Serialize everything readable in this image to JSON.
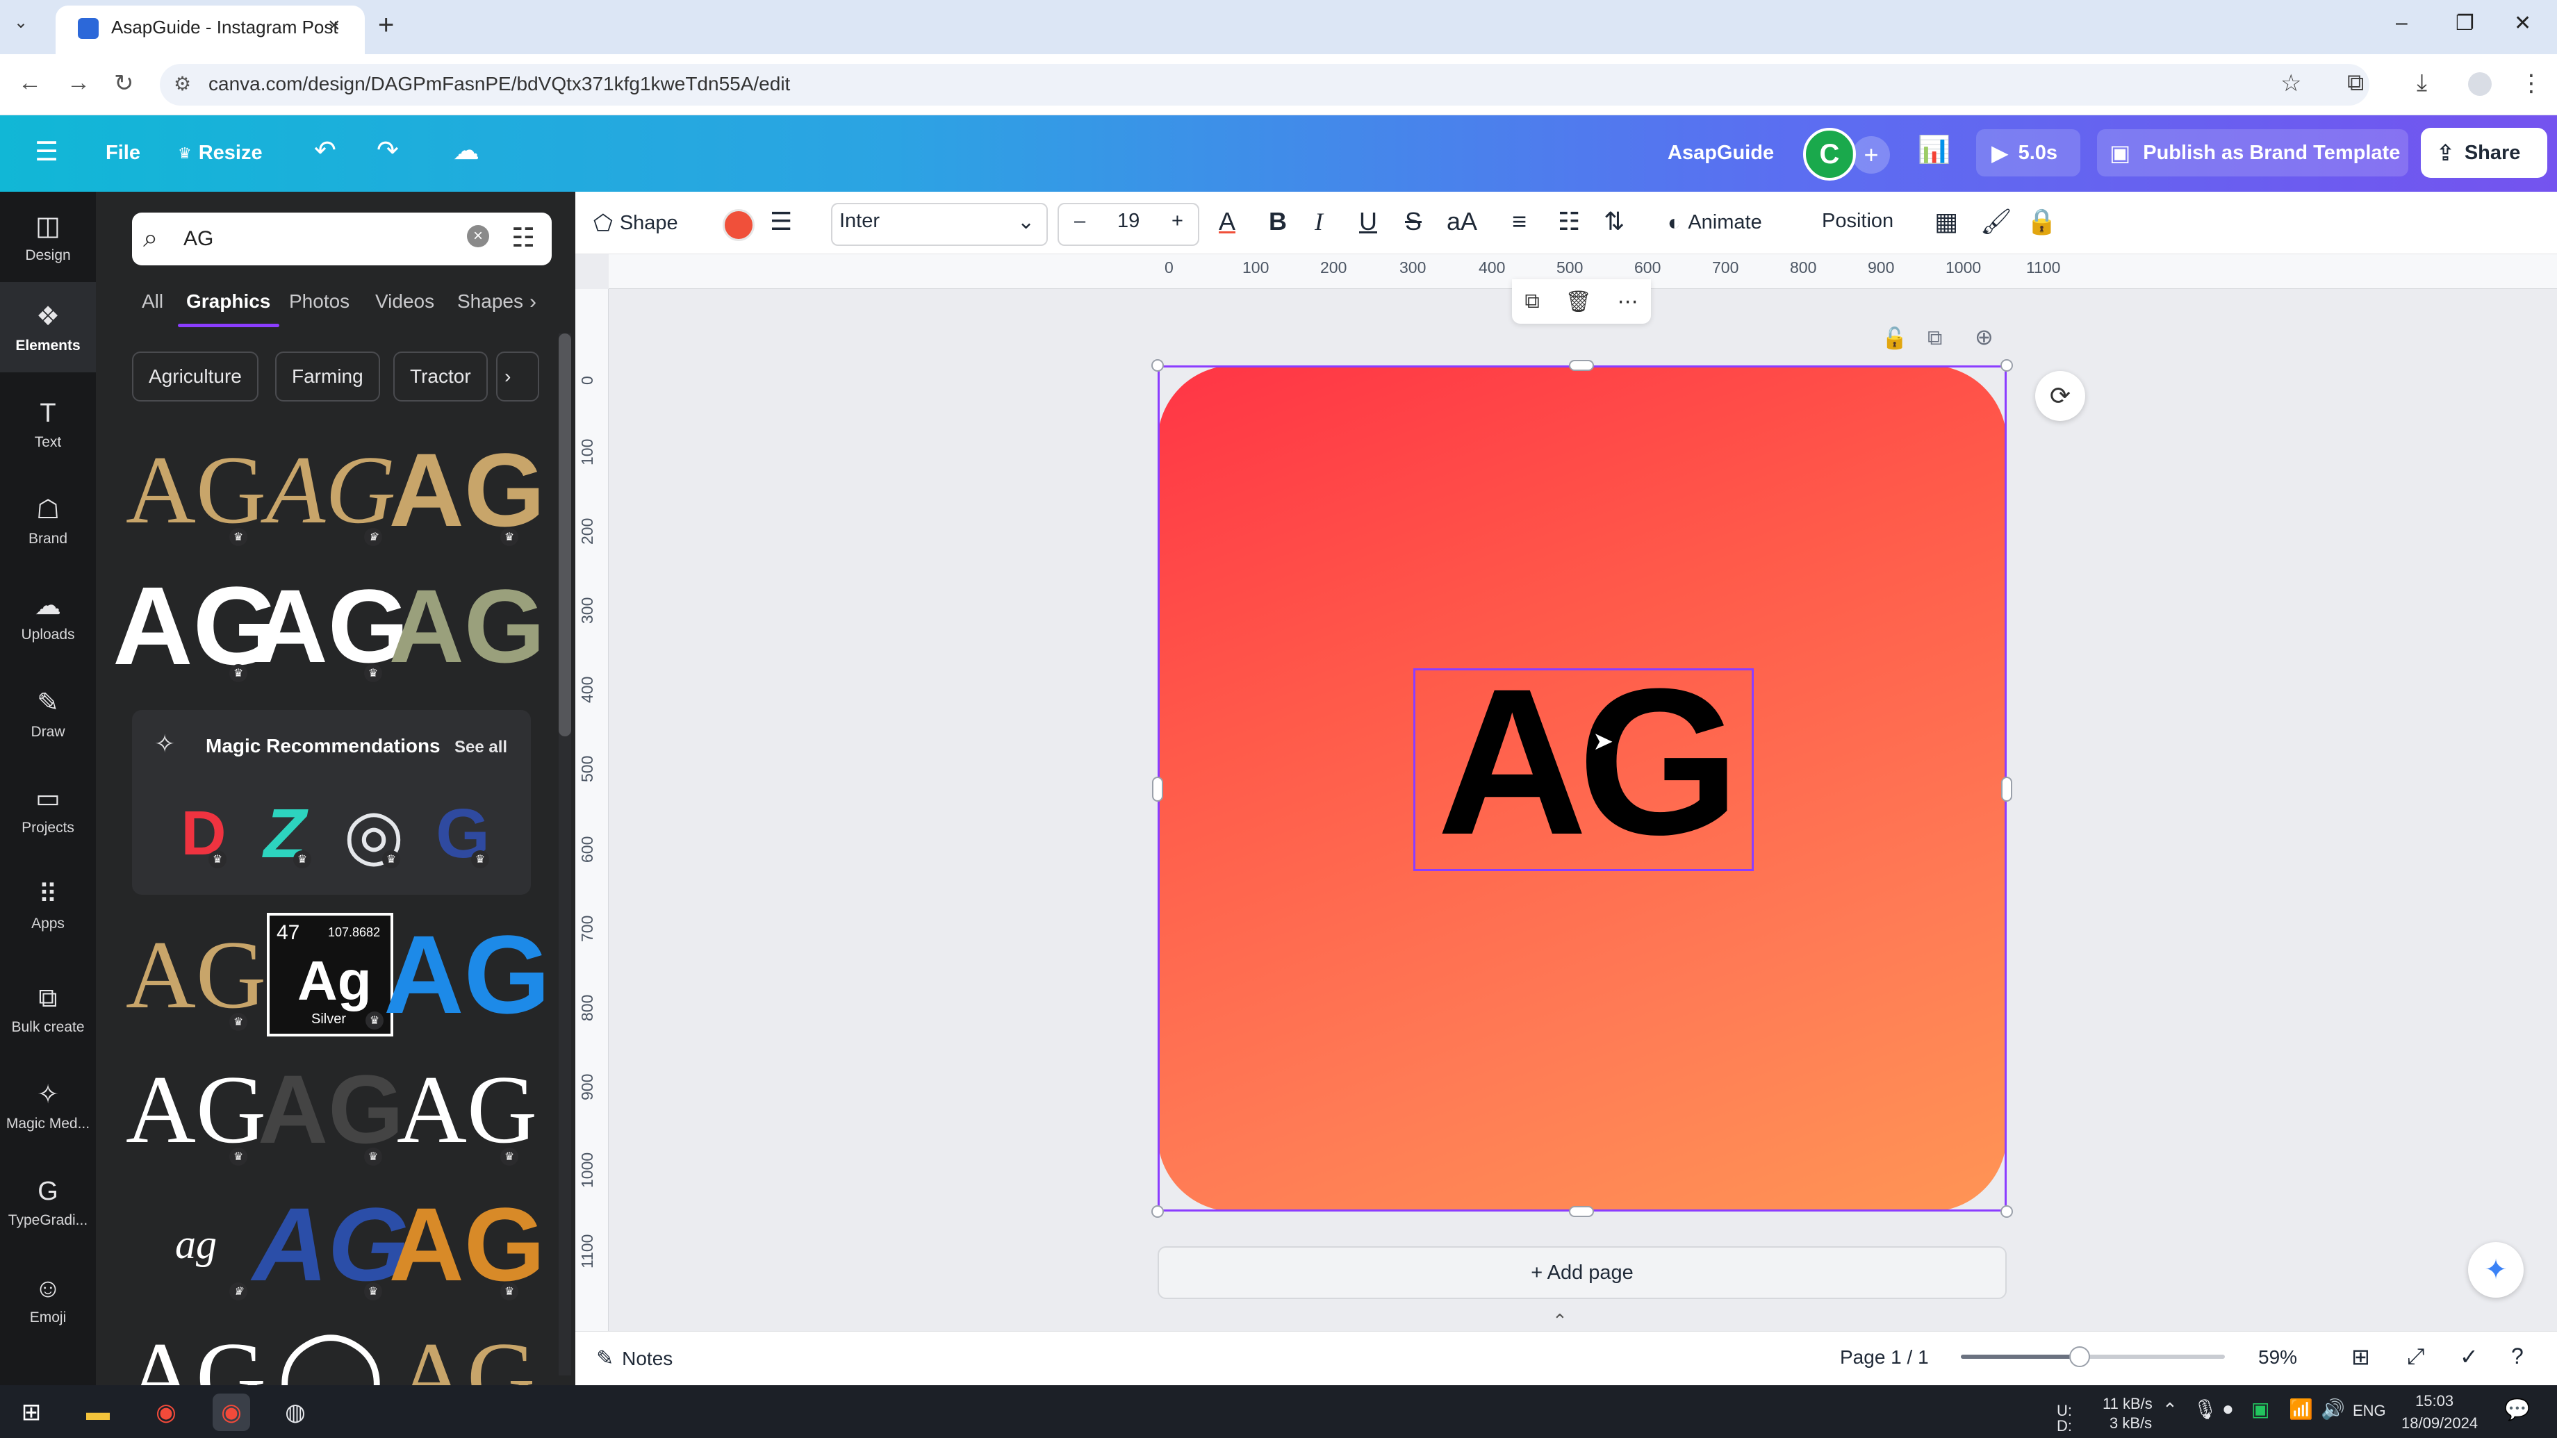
{
  "browser": {
    "tab_title": "AsapGuide - Instagram Post",
    "url": "canva.com/design/DAGPmFasnPE/bdVQtx371kfg1kweTdn55A/edit"
  },
  "header": {
    "file": "File",
    "resize": "Resize",
    "team_name": "AsapGuide",
    "avatar_letter": "C",
    "play_time": "5.0s",
    "publish": "Publish as Brand Template",
    "share": "Share"
  },
  "rail": [
    {
      "label": "Design",
      "icon": "layout-icon"
    },
    {
      "label": "Elements",
      "icon": "shapes-icon"
    },
    {
      "label": "Text",
      "icon": "text-icon"
    },
    {
      "label": "Brand",
      "icon": "brand-icon"
    },
    {
      "label": "Uploads",
      "icon": "cloud-upload-icon"
    },
    {
      "label": "Draw",
      "icon": "pen-icon"
    },
    {
      "label": "Projects",
      "icon": "folder-icon"
    },
    {
      "label": "Apps",
      "icon": "grid-icon"
    },
    {
      "label": "Bulk create",
      "icon": "bulk-icon"
    },
    {
      "label": "Magic Med...",
      "icon": "magic-media-icon"
    },
    {
      "label": "TypeGradi...",
      "icon": "typegradient-icon"
    },
    {
      "label": "Emoji",
      "icon": "emoji-icon"
    }
  ],
  "panel": {
    "search_value": "AG",
    "tabs": [
      "All",
      "Graphics",
      "Photos",
      "Videos",
      "Shapes"
    ],
    "chips": [
      "Agriculture",
      "Farming",
      "Tractor"
    ],
    "magic_title": "Magic Recommendations",
    "see_all": "See all",
    "silver_tile": {
      "number": "47",
      "mass": "107.8682",
      "symbol": "Ag",
      "name": "Silver"
    },
    "ag_text": "AG",
    "script_ag": "ag"
  },
  "toolbar": {
    "shape": "Shape",
    "font": "Inter",
    "font_size": "19",
    "animate": "Animate",
    "position": "Position"
  },
  "ruler": {
    "h": [
      "0",
      "100",
      "200",
      "300",
      "400",
      "500",
      "600",
      "700",
      "800",
      "900",
      "1000",
      "1100"
    ],
    "v": [
      "0",
      "100",
      "200",
      "300",
      "400",
      "500",
      "600",
      "700",
      "800",
      "900",
      "1000",
      "1100"
    ]
  },
  "canvas": {
    "logo_text": "AG",
    "add_page": "+ Add page",
    "background_colors": [
      "#ff3545",
      "#ff9555"
    ]
  },
  "footer": {
    "notes": "Notes",
    "page": "Page 1 / 1",
    "zoom": "59%",
    "zoom_level": 0.45
  },
  "taskbar": {
    "net_up": "11 kB/s",
    "net_down": "3 kB/s",
    "net_u": "U:",
    "net_d": "D:",
    "lang": "ENG",
    "time": "15:03",
    "date": "18/09/2024"
  }
}
